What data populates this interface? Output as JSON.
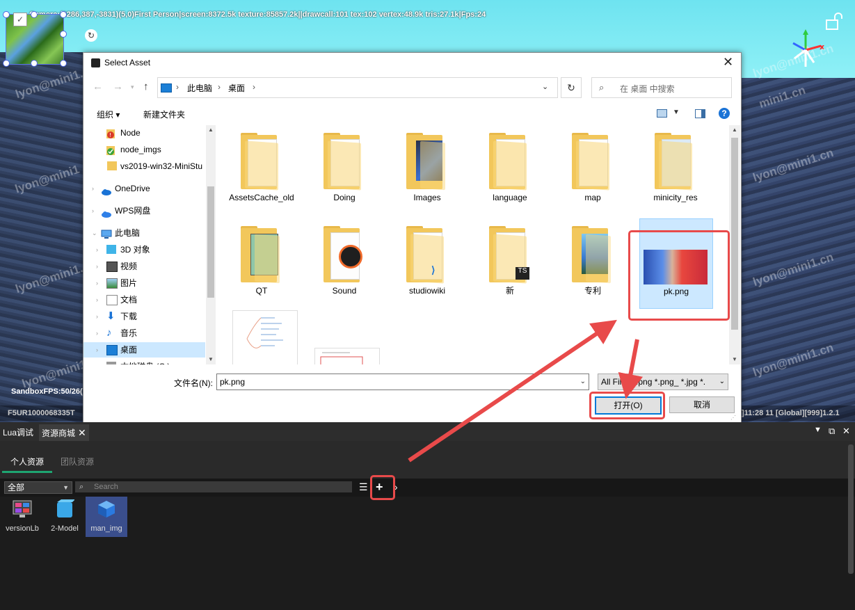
{
  "viewport": {
    "info_bar": "Camera:(9286,387,-3831)(5,0)First Person|screen:8372.5k texture:85857.2k||drawcall:101 tex:102 vertex:48.9k tris:27.1k|Fps:24",
    "watermark": "lyon@mini1.cn",
    "watermark_short": "lyon@mini1",
    "watermark_cn": "mini1.cn",
    "sandbox_fps": "SandboxFPS:50/26(",
    "status_left": "F5UR1000068335T",
    "status_right": "]11:28 11  [Global][999]1.2.1"
  },
  "dialog": {
    "title": "Select Asset",
    "path": [
      "此电脑",
      "桌面"
    ],
    "search_placeholder": "在 桌面 中搜索",
    "toolbar": {
      "organize": "组织 ▾",
      "new_folder": "新建文件夹"
    },
    "tree": [
      {
        "label": "Node",
        "icon": "warning-icon"
      },
      {
        "label": "node_imgs",
        "icon": "check-icon"
      },
      {
        "label": "vs2019-win32-MiniStu",
        "icon": "folder-icon"
      },
      {
        "label": "OneDrive",
        "icon": "cloud-icon"
      },
      {
        "label": "WPS网盘",
        "icon": "cloud-icon"
      },
      {
        "label": "此电脑",
        "icon": "computer-icon"
      },
      {
        "label": "3D 对象",
        "icon": "cube-icon"
      },
      {
        "label": "视频",
        "icon": "video-icon"
      },
      {
        "label": "图片",
        "icon": "picture-icon"
      },
      {
        "label": "文档",
        "icon": "document-icon"
      },
      {
        "label": "下载",
        "icon": "download-icon"
      },
      {
        "label": "音乐",
        "icon": "music-icon"
      },
      {
        "label": "桌面",
        "icon": "desktop-icon"
      },
      {
        "label": "本地磁盘 (C:)",
        "icon": "drive-icon"
      }
    ],
    "files": [
      {
        "name": "AssetsCache_old"
      },
      {
        "name": "Doing"
      },
      {
        "name": "Images"
      },
      {
        "name": "language"
      },
      {
        "name": "map"
      },
      {
        "name": "minicity_res"
      },
      {
        "name": "QT"
      },
      {
        "name": "Sound"
      },
      {
        "name": "studiowiki"
      },
      {
        "name": "新"
      },
      {
        "name": "专利"
      },
      {
        "name": "pk.png"
      }
    ],
    "filename_label": "文件名(N):",
    "filename_value": "pk.png",
    "filetype_value": "All Files *.png *.png_ *.jpg *.",
    "open_label": "打开(O)",
    "cancel_label": "取消"
  },
  "panel": {
    "tabs": [
      {
        "label": "Lua调试"
      },
      {
        "label": "资源商城"
      }
    ],
    "subtabs": [
      {
        "label": "个人资源"
      },
      {
        "label": "团队资源"
      }
    ],
    "filter_value": "全部",
    "search_placeholder": "Search",
    "assets": [
      {
        "name": "versionLb",
        "icon": "monitor-icon"
      },
      {
        "name": "2-Model",
        "icon": "cube-icon"
      },
      {
        "name": "man_img",
        "icon": "cube-icon"
      }
    ]
  },
  "colors": {
    "annotation": "#e84a4a",
    "accent": "#0078d7",
    "tab_underline": "#1ea672",
    "selected_asset": "#3a4e8c"
  }
}
